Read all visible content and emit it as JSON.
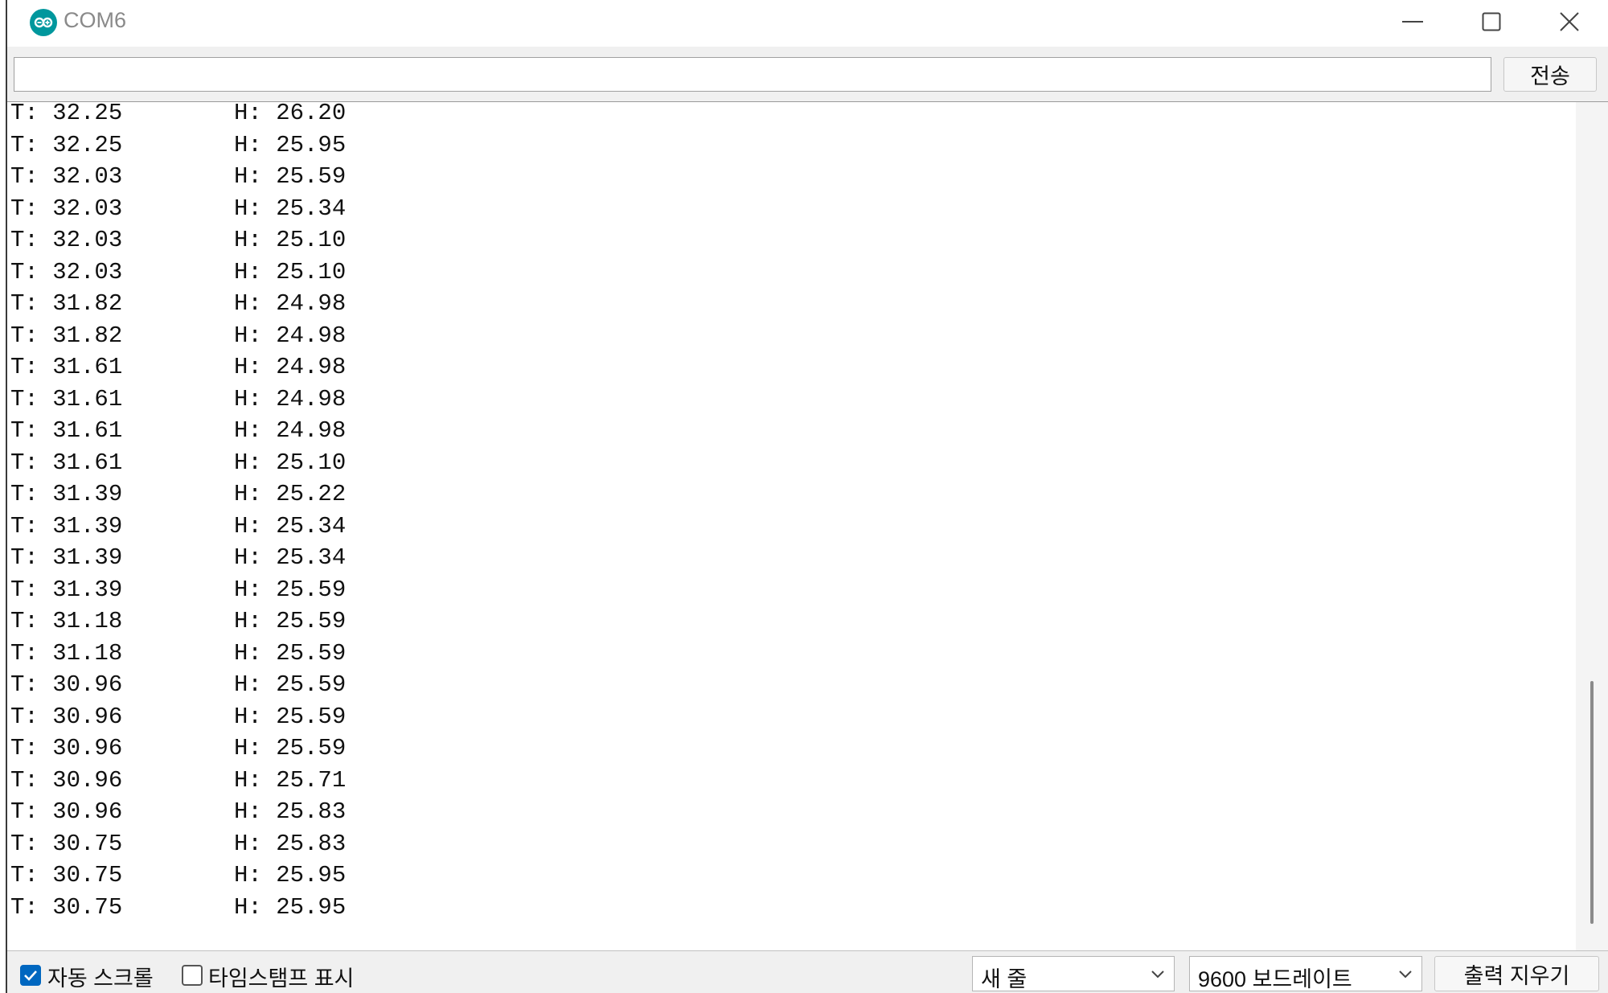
{
  "window": {
    "title": "COM6",
    "icon": "arduino-logo-icon",
    "controls": [
      "minimize-icon",
      "maximize-icon",
      "close-icon"
    ]
  },
  "send": {
    "input_value": "",
    "button_label": "전송"
  },
  "output": {
    "lines": [
      {
        "t": "T: 32.25",
        "h": "H: 26.20"
      },
      {
        "t": "T: 32.25",
        "h": "H: 25.95"
      },
      {
        "t": "T: 32.03",
        "h": "H: 25.59"
      },
      {
        "t": "T: 32.03",
        "h": "H: 25.34"
      },
      {
        "t": "T: 32.03",
        "h": "H: 25.10"
      },
      {
        "t": "T: 32.03",
        "h": "H: 25.10"
      },
      {
        "t": "T: 31.82",
        "h": "H: 24.98"
      },
      {
        "t": "T: 31.82",
        "h": "H: 24.98"
      },
      {
        "t": "T: 31.61",
        "h": "H: 24.98"
      },
      {
        "t": "T: 31.61",
        "h": "H: 24.98"
      },
      {
        "t": "T: 31.61",
        "h": "H: 24.98"
      },
      {
        "t": "T: 31.61",
        "h": "H: 25.10"
      },
      {
        "t": "T: 31.39",
        "h": "H: 25.22"
      },
      {
        "t": "T: 31.39",
        "h": "H: 25.34"
      },
      {
        "t": "T: 31.39",
        "h": "H: 25.34"
      },
      {
        "t": "T: 31.39",
        "h": "H: 25.59"
      },
      {
        "t": "T: 31.18",
        "h": "H: 25.59"
      },
      {
        "t": "T: 31.18",
        "h": "H: 25.59"
      },
      {
        "t": "T: 30.96",
        "h": "H: 25.59"
      },
      {
        "t": "T: 30.96",
        "h": "H: 25.59"
      },
      {
        "t": "T: 30.96",
        "h": "H: 25.59"
      },
      {
        "t": "T: 30.96",
        "h": "H: 25.71"
      },
      {
        "t": "T: 30.96",
        "h": "H: 25.83"
      },
      {
        "t": "T: 30.75",
        "h": "H: 25.83"
      },
      {
        "t": "T: 30.75",
        "h": "H: 25.95"
      },
      {
        "t": "T: 30.75",
        "h": "H: 25.95"
      }
    ]
  },
  "footer": {
    "autoscroll": {
      "label": "자동 스크롤",
      "checked": true
    },
    "timestamp": {
      "label": "타임스탬프 표시",
      "checked": false
    },
    "line_ending": {
      "value": "새 줄"
    },
    "baud_rate": {
      "value": "9600 보드레이트"
    },
    "clear_button_label": "출력 지우기"
  },
  "colors": {
    "accent": "#0067c0",
    "arduino_teal": "#00979d"
  }
}
